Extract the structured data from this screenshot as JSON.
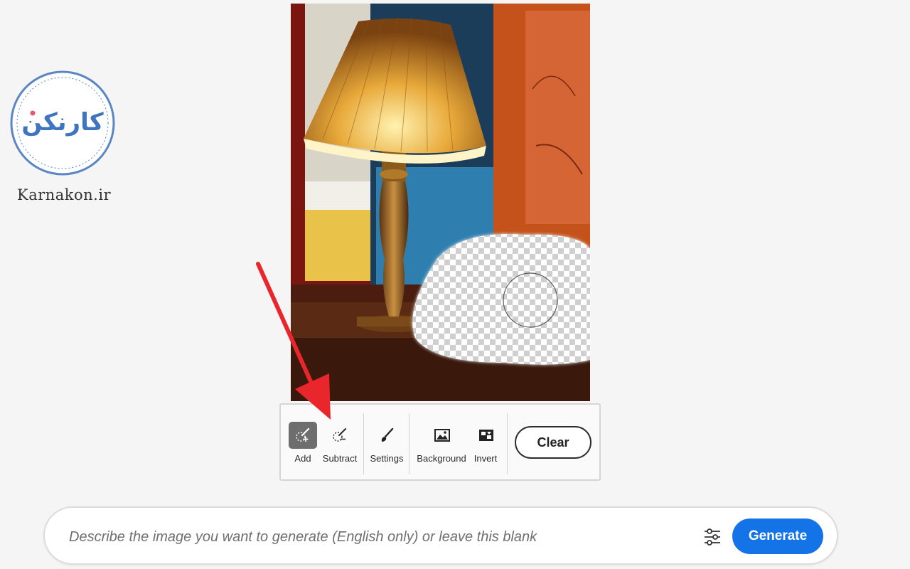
{
  "watermark": {
    "logo_text": "کارنکن",
    "caption": "Karnakon.ir"
  },
  "canvas": {
    "image_subject": "table lamp with generative-fill erase mask"
  },
  "toolbar": {
    "tools": [
      {
        "label": "Add",
        "icon": "brush-add-icon",
        "active": true
      },
      {
        "label": "Subtract",
        "icon": "brush-subtract-icon",
        "active": false
      },
      {
        "label": "Settings",
        "icon": "paintbrush-icon",
        "active": false
      },
      {
        "label": "Background",
        "icon": "image-icon",
        "active": false
      },
      {
        "label": "Invert",
        "icon": "invert-icon",
        "active": false
      }
    ],
    "clear_label": "Clear"
  },
  "prompt": {
    "placeholder": "Describe the image you want to generate (English only) or leave this blank",
    "value": "",
    "settings_icon": "sliders-icon",
    "generate_label": "Generate"
  },
  "colors": {
    "accent": "#1473e6",
    "active_tool": "#6e6e6e",
    "annotation_arrow": "#e8262b",
    "logo_ring": "#5a86c5",
    "logo_text": "#3f74c0"
  }
}
